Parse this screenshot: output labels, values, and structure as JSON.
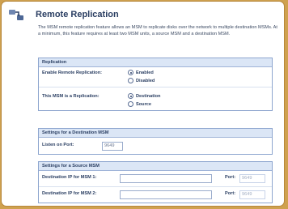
{
  "page": {
    "title": "Remote Replication",
    "description": "The MSM remote replication feature allows an MSM to replicate disks over the network to multiple destination MSMs. At a minimum, this feature requires at least two MSM units, a source MSM and a destination MSM."
  },
  "replication": {
    "header": "Replication",
    "enable_label": "Enable Remote Replication:",
    "enable_options": [
      "Enabled",
      "Disabled"
    ],
    "enable_selected": "Enabled",
    "role_label": "This MSM is a Replication:",
    "role_options": [
      "Destination",
      "Source"
    ],
    "role_selected": "Destination"
  },
  "destination": {
    "header": "Settings for a Destination MSM",
    "listen_label": "Listen on Port:",
    "listen_value": "9649"
  },
  "source": {
    "header": "Settings for a Source MSM",
    "rows": [
      {
        "label": "Destination IP for MSM 1:",
        "ip": "",
        "port_label": "Port:",
        "port_value": "9649"
      },
      {
        "label": "Destination IP for MSM 2:",
        "ip": "",
        "port_label": "Port:",
        "port_value": "9649"
      }
    ]
  },
  "colors": {
    "background": "#cfa14f",
    "panel_border": "#8ea6cf",
    "header_bg": "#dbe6f6",
    "text": "#2a3e62"
  }
}
